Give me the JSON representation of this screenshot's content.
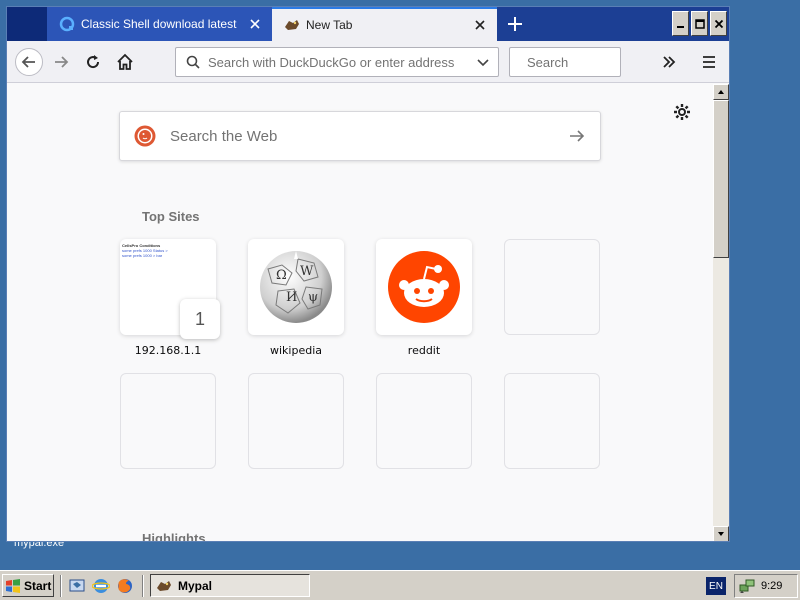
{
  "desktop": {
    "icon_label": "mypal.exe"
  },
  "browser": {
    "tabs": [
      {
        "title": "Classic Shell download latest versi",
        "active": false
      },
      {
        "title": "New Tab",
        "active": true
      }
    ],
    "urlbar": {
      "placeholder": "Search with DuckDuckGo or enter address"
    },
    "searchbar": {
      "placeholder": "Search"
    }
  },
  "newtab": {
    "search_placeholder": "Search the Web",
    "top_sites_title": "Top Sites",
    "highlights_title": "Highlights",
    "top_sites": [
      {
        "label": "192.168.1.1",
        "pin": "1",
        "thumb_lines": [
          "CellsPro Conditions",
          "some prefs 1000 Status >",
          "some prefs 1000 > bar"
        ]
      },
      {
        "label": "wikipedia"
      },
      {
        "label": "reddit"
      }
    ]
  },
  "taskbar": {
    "start_label": "Start",
    "task_label": "Mypal",
    "language": "EN",
    "clock": "9:29"
  },
  "colors": {
    "tabbar": "#1c3f94",
    "active_tab_accent": "#2c7be5",
    "reddit_orange": "#ff4500",
    "duckduckgo": "#de5833",
    "desktop": "#3a6ea5"
  }
}
